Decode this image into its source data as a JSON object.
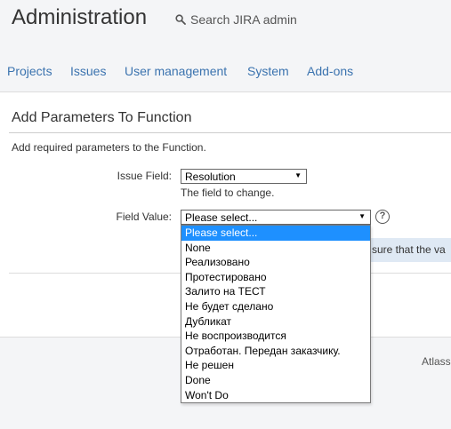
{
  "header": {
    "title": "Administration",
    "search_label": "Search JIRA admin"
  },
  "nav": {
    "items": [
      "Projects",
      "Issues",
      "User management",
      "System",
      "Add-ons"
    ]
  },
  "page": {
    "title": "Add Parameters To Function",
    "description": "Add required parameters to the Function."
  },
  "form": {
    "issue_field": {
      "label": "Issue Field:",
      "value": "Resolution",
      "description": "The field to change."
    },
    "field_value": {
      "label": "Field Value:",
      "value": "Please select...",
      "options": [
        "Please select...",
        "None",
        "Реализовано",
        "Протестировано",
        "Залито на ТЕСТ",
        "Не будет сделано",
        "Дубликат",
        "Не воспроизводится",
        "Отработан. Передан заказчику.",
        "Не решен",
        "Done",
        "Won't Do"
      ],
      "selected_index": 0
    },
    "help_glyph": "?",
    "warning_text": "sure that the va"
  },
  "footer": {
    "text": "Atlass"
  },
  "colors": {
    "link": "#3b73af",
    "selected_option": "#1e90ff",
    "warning_bg": "#dfe9f4"
  }
}
